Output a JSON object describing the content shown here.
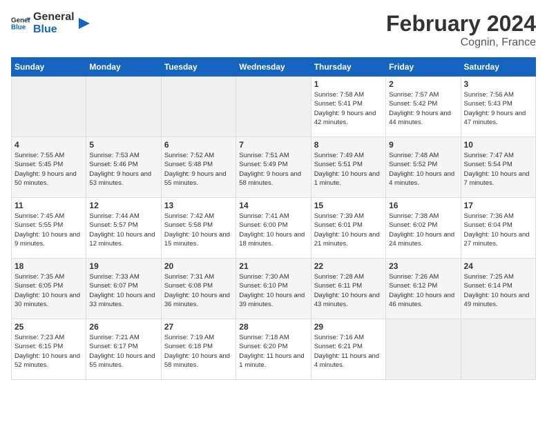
{
  "header": {
    "logo_general": "General",
    "logo_blue": "Blue",
    "title": "February 2024",
    "subtitle": "Cognin, France"
  },
  "days_of_week": [
    "Sunday",
    "Monday",
    "Tuesday",
    "Wednesday",
    "Thursday",
    "Friday",
    "Saturday"
  ],
  "weeks": [
    [
      {
        "num": "",
        "empty": true
      },
      {
        "num": "",
        "empty": true
      },
      {
        "num": "",
        "empty": true
      },
      {
        "num": "",
        "empty": true
      },
      {
        "num": "1",
        "sunrise": "Sunrise: 7:58 AM",
        "sunset": "Sunset: 5:41 PM",
        "daylight": "Daylight: 9 hours and 42 minutes."
      },
      {
        "num": "2",
        "sunrise": "Sunrise: 7:57 AM",
        "sunset": "Sunset: 5:42 PM",
        "daylight": "Daylight: 9 hours and 44 minutes."
      },
      {
        "num": "3",
        "sunrise": "Sunrise: 7:56 AM",
        "sunset": "Sunset: 5:43 PM",
        "daylight": "Daylight: 9 hours and 47 minutes."
      }
    ],
    [
      {
        "num": "4",
        "sunrise": "Sunrise: 7:55 AM",
        "sunset": "Sunset: 5:45 PM",
        "daylight": "Daylight: 9 hours and 50 minutes."
      },
      {
        "num": "5",
        "sunrise": "Sunrise: 7:53 AM",
        "sunset": "Sunset: 5:46 PM",
        "daylight": "Daylight: 9 hours and 53 minutes."
      },
      {
        "num": "6",
        "sunrise": "Sunrise: 7:52 AM",
        "sunset": "Sunset: 5:48 PM",
        "daylight": "Daylight: 9 hours and 55 minutes."
      },
      {
        "num": "7",
        "sunrise": "Sunrise: 7:51 AM",
        "sunset": "Sunset: 5:49 PM",
        "daylight": "Daylight: 9 hours and 58 minutes."
      },
      {
        "num": "8",
        "sunrise": "Sunrise: 7:49 AM",
        "sunset": "Sunset: 5:51 PM",
        "daylight": "Daylight: 10 hours and 1 minute."
      },
      {
        "num": "9",
        "sunrise": "Sunrise: 7:48 AM",
        "sunset": "Sunset: 5:52 PM",
        "daylight": "Daylight: 10 hours and 4 minutes."
      },
      {
        "num": "10",
        "sunrise": "Sunrise: 7:47 AM",
        "sunset": "Sunset: 5:54 PM",
        "daylight": "Daylight: 10 hours and 7 minutes."
      }
    ],
    [
      {
        "num": "11",
        "sunrise": "Sunrise: 7:45 AM",
        "sunset": "Sunset: 5:55 PM",
        "daylight": "Daylight: 10 hours and 9 minutes."
      },
      {
        "num": "12",
        "sunrise": "Sunrise: 7:44 AM",
        "sunset": "Sunset: 5:57 PM",
        "daylight": "Daylight: 10 hours and 12 minutes."
      },
      {
        "num": "13",
        "sunrise": "Sunrise: 7:42 AM",
        "sunset": "Sunset: 5:58 PM",
        "daylight": "Daylight: 10 hours and 15 minutes."
      },
      {
        "num": "14",
        "sunrise": "Sunrise: 7:41 AM",
        "sunset": "Sunset: 6:00 PM",
        "daylight": "Daylight: 10 hours and 18 minutes."
      },
      {
        "num": "15",
        "sunrise": "Sunrise: 7:39 AM",
        "sunset": "Sunset: 6:01 PM",
        "daylight": "Daylight: 10 hours and 21 minutes."
      },
      {
        "num": "16",
        "sunrise": "Sunrise: 7:38 AM",
        "sunset": "Sunset: 6:02 PM",
        "daylight": "Daylight: 10 hours and 24 minutes."
      },
      {
        "num": "17",
        "sunrise": "Sunrise: 7:36 AM",
        "sunset": "Sunset: 6:04 PM",
        "daylight": "Daylight: 10 hours and 27 minutes."
      }
    ],
    [
      {
        "num": "18",
        "sunrise": "Sunrise: 7:35 AM",
        "sunset": "Sunset: 6:05 PM",
        "daylight": "Daylight: 10 hours and 30 minutes."
      },
      {
        "num": "19",
        "sunrise": "Sunrise: 7:33 AM",
        "sunset": "Sunset: 6:07 PM",
        "daylight": "Daylight: 10 hours and 33 minutes."
      },
      {
        "num": "20",
        "sunrise": "Sunrise: 7:31 AM",
        "sunset": "Sunset: 6:08 PM",
        "daylight": "Daylight: 10 hours and 36 minutes."
      },
      {
        "num": "21",
        "sunrise": "Sunrise: 7:30 AM",
        "sunset": "Sunset: 6:10 PM",
        "daylight": "Daylight: 10 hours and 39 minutes."
      },
      {
        "num": "22",
        "sunrise": "Sunrise: 7:28 AM",
        "sunset": "Sunset: 6:11 PM",
        "daylight": "Daylight: 10 hours and 43 minutes."
      },
      {
        "num": "23",
        "sunrise": "Sunrise: 7:26 AM",
        "sunset": "Sunset: 6:12 PM",
        "daylight": "Daylight: 10 hours and 46 minutes."
      },
      {
        "num": "24",
        "sunrise": "Sunrise: 7:25 AM",
        "sunset": "Sunset: 6:14 PM",
        "daylight": "Daylight: 10 hours and 49 minutes."
      }
    ],
    [
      {
        "num": "25",
        "sunrise": "Sunrise: 7:23 AM",
        "sunset": "Sunset: 6:15 PM",
        "daylight": "Daylight: 10 hours and 52 minutes."
      },
      {
        "num": "26",
        "sunrise": "Sunrise: 7:21 AM",
        "sunset": "Sunset: 6:17 PM",
        "daylight": "Daylight: 10 hours and 55 minutes."
      },
      {
        "num": "27",
        "sunrise": "Sunrise: 7:19 AM",
        "sunset": "Sunset: 6:18 PM",
        "daylight": "Daylight: 10 hours and 58 minutes."
      },
      {
        "num": "28",
        "sunrise": "Sunrise: 7:18 AM",
        "sunset": "Sunset: 6:20 PM",
        "daylight": "Daylight: 11 hours and 1 minute."
      },
      {
        "num": "29",
        "sunrise": "Sunrise: 7:16 AM",
        "sunset": "Sunset: 6:21 PM",
        "daylight": "Daylight: 11 hours and 4 minutes."
      },
      {
        "num": "",
        "empty": true
      },
      {
        "num": "",
        "empty": true
      }
    ]
  ]
}
